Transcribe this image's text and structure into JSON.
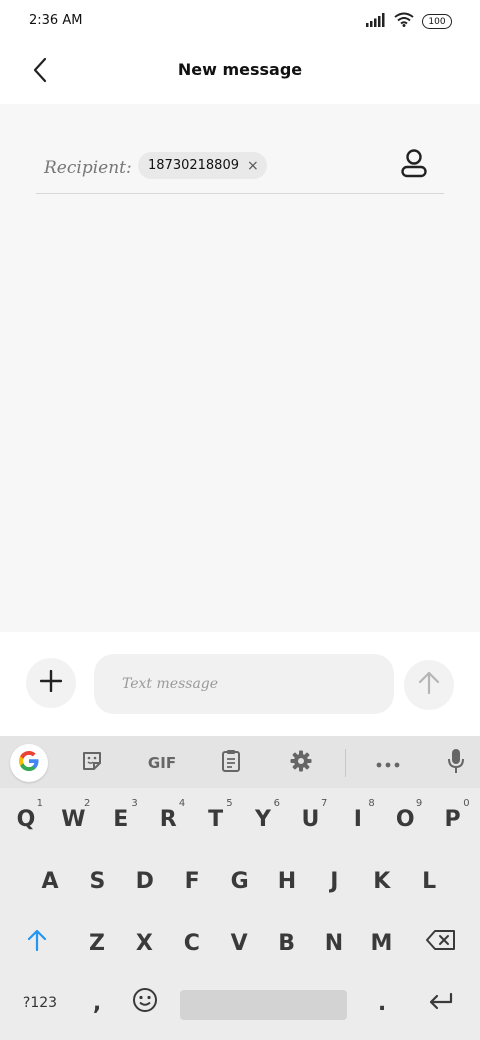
{
  "status_bar": {
    "time": "2:36 AM",
    "battery": "100"
  },
  "header": {
    "title": "New message",
    "back_icon": "chevron-left-icon"
  },
  "recipient": {
    "label": "Recipient:",
    "chip_value": "18730218809",
    "chip_remove": "×",
    "contact_icon": "person-icon"
  },
  "compose": {
    "placeholder": "Text message",
    "value": "",
    "add_icon": "plus-icon",
    "send_icon": "arrow-up-icon"
  },
  "keyboard": {
    "toolbar": {
      "gif_label": "GIF"
    },
    "rows": [
      [
        {
          "k": "Q",
          "h": "1"
        },
        {
          "k": "W",
          "h": "2"
        },
        {
          "k": "E",
          "h": "3"
        },
        {
          "k": "R",
          "h": "4"
        },
        {
          "k": "T",
          "h": "5"
        },
        {
          "k": "Y",
          "h": "6"
        },
        {
          "k": "U",
          "h": "7"
        },
        {
          "k": "I",
          "h": "8"
        },
        {
          "k": "O",
          "h": "9"
        },
        {
          "k": "P",
          "h": "0"
        }
      ],
      [
        {
          "k": "A"
        },
        {
          "k": "S"
        },
        {
          "k": "D"
        },
        {
          "k": "F"
        },
        {
          "k": "G"
        },
        {
          "k": "H"
        },
        {
          "k": "J"
        },
        {
          "k": "K"
        },
        {
          "k": "L"
        }
      ],
      [
        {
          "k": "Z"
        },
        {
          "k": "X"
        },
        {
          "k": "C"
        },
        {
          "k": "V"
        },
        {
          "k": "B"
        },
        {
          "k": "N"
        },
        {
          "k": "M"
        }
      ]
    ],
    "symbols_label": "?123",
    "comma_label": ",",
    "period_label": "."
  },
  "colors": {
    "accent": "#2196f3",
    "content_bg": "#f7f7f7",
    "keyboard_bg": "#ececec"
  }
}
